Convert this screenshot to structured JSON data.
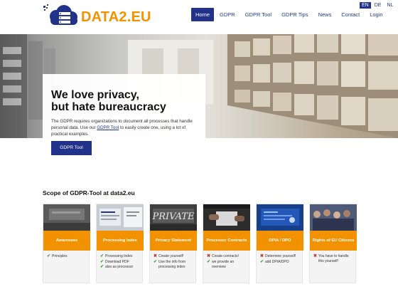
{
  "brand": {
    "logo_primary": "DATA2",
    "logo_secondary": ".EU",
    "accent_color": "#f39200",
    "primary_color": "#22318a"
  },
  "nav": {
    "items": [
      {
        "label": "Home",
        "active": true
      },
      {
        "label": "GDPR"
      },
      {
        "label": "GDPR Tool"
      },
      {
        "label": "GDPR Tips"
      },
      {
        "label": "News"
      },
      {
        "label": "Contact"
      },
      {
        "label": "Login"
      }
    ]
  },
  "languages": [
    {
      "label": "EN",
      "active": true
    },
    {
      "label": "DE"
    },
    {
      "label": "NL"
    }
  ],
  "hero": {
    "title_line1": "We love privacy,",
    "title_line2": "but hate bureaucracy",
    "text_before": "The GDPR requires organizations to document all processes that handle personal data. Use our ",
    "link": "GDPR Tool",
    "text_after": " to easily create one, using a lot of practical examples.",
    "button": "GDPR Tool"
  },
  "scope": {
    "title": "Scope of GDPR-Tool at data2.eu",
    "cards": [
      {
        "icon": "awareness-image",
        "title": "Awareness",
        "items": [
          {
            "text": "Principles",
            "ok": true
          }
        ]
      },
      {
        "icon": "processing-index-image",
        "title": "Processing Index",
        "items": [
          {
            "text": "Processing Index",
            "ok": true
          },
          {
            "text": "Download PDF",
            "ok": true
          },
          {
            "text": "also as processor",
            "ok": true
          }
        ]
      },
      {
        "icon": "privacy-statement-image",
        "title": "Privacy Statement",
        "items": [
          {
            "text": "Create yourself!",
            "ok": false
          },
          {
            "text": "Use the info from processing index",
            "ok": true
          }
        ]
      },
      {
        "icon": "processor-contracts-image",
        "title": "Processor Contracts",
        "items": [
          {
            "text": "Create contracts!",
            "ok": false
          },
          {
            "text": "we provide an overview",
            "ok": true
          }
        ]
      },
      {
        "icon": "dpia-dpo-image",
        "title": "DPIA / DPO",
        "items": [
          {
            "text": "Determine yourself!",
            "ok": false
          },
          {
            "text": "add DPIA/DPO",
            "ok": true
          }
        ]
      },
      {
        "icon": "rights-eu-citizens-image",
        "title": "Rights of EU Citizens",
        "items": [
          {
            "text": "You have to handle this yourself!",
            "ok": false
          }
        ]
      }
    ]
  }
}
